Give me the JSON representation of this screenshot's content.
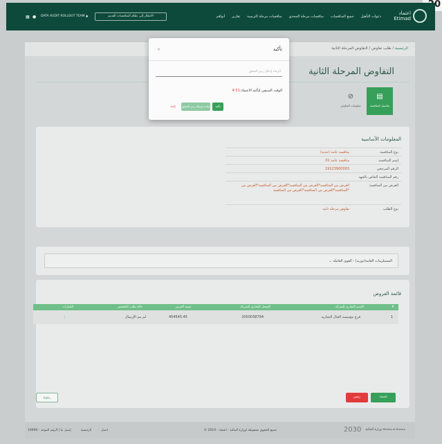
{
  "corner_badge": "20",
  "header": {
    "logo": {
      "ar": "اعتماد",
      "en": "Etimad"
    },
    "nav": [
      "دعوات التأهيل",
      "جميع المنافسات",
      "منافسات مرحلة المحدي",
      "منافسات مرحلة الترسية",
      "تقارير",
      "أبواقم"
    ],
    "old_system_btn": "الانتقال إلى نظام المنافسات القديم",
    "user": "DATA AUDIT ROLLOUT TEAM"
  },
  "breadcrumb": {
    "home": "الرئيسية",
    "sep1": " / ",
    "mid": "طلب تفاوض",
    "sep2": " / ",
    "current": "التفاوض المرحلة الثانية"
  },
  "page_title": "التفاوض المرحلة الثانية",
  "tabs": {
    "details": "تفاصيل المنافسة",
    "info": "معلومات التفاوض"
  },
  "basic_info": {
    "title": "المعلومات الأساسية",
    "rows": [
      {
        "k": "نوع المنافسة",
        "v": "منافسة عامة (جديد)"
      },
      {
        "k": "إسم المنافسة",
        "v": "منافسة عامة 01"
      },
      {
        "k": "الرقم المرجعي",
        "v": "19123900003"
      },
      {
        "k": "رقم المنافسة الخاص بالجهة",
        "v": ""
      },
      {
        "k": "الغرض من المنافسة",
        "v": "الغرض من المنافسة*الغرض من المنافسة*الغرض من المنافسة*الغرض من المنافسة*الغرض من المنافسة*الغرض من المنافسة*"
      },
      {
        "k": "نوع الطلب",
        "v": "تفاوض مرحلة ثانية"
      }
    ]
  },
  "dropdown_label": "المستلزمات العامة(توريد) - القوى العاملة",
  "offers": {
    "title": "قائمة العروض",
    "headers": {
      "num": "#",
      "company": "الإسم التجاري للشركة",
      "cr": "السجل التجاري للشركة",
      "value": "قيمة العرض",
      "status": "حالة طلب التخفيض",
      "actions": "الخيارات"
    },
    "rows": [
      {
        "num": "1",
        "company": "فرع مؤسسة الخال التجارية",
        "cr": "2050038794",
        "value": "454545.45",
        "status": "لم يتم الإرسال",
        "actions": "⋮"
      }
    ]
  },
  "buttons": {
    "approve": "اعتماد",
    "reject": "رفض",
    "prev": "رجوع"
  },
  "footer": {
    "mof_ar": "وزارة المالية",
    "mof_en": "Ministry of Finance",
    "vision": "2030",
    "copyright": "© جميع الحقوق محفوظة لوزارة المالية - اعتماد - 2019",
    "links": [
      "اتصل",
      "الرئيسية",
      "إتصل بنا | الرقم الموحد : 19990"
    ]
  },
  "modal": {
    "title": "تأكيد",
    "close": "×",
    "input_placeholder": "الرجاء إدخال رمز التحقق",
    "timer_label": "الوقت المتبقي لتأكيد الاعتماد:",
    "timer_value": "4:51",
    "confirm": "تأكيد",
    "resend": "إعادة إرسال رمز التحقق",
    "cancel": "إلغاء"
  },
  "colors": {
    "header": "#0d4a3b",
    "green": "#36a05a",
    "red": "#e23b3b"
  }
}
